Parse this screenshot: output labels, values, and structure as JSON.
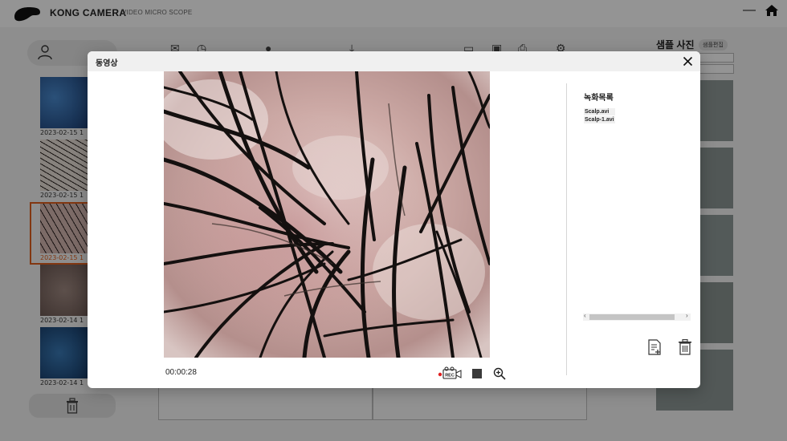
{
  "app": {
    "brand": "KONG CAMERA",
    "brand_sub": "VIDEO MICRO SCOPE",
    "minimize_glyph": "—"
  },
  "left_panel": {
    "thumbnails": [
      {
        "date": "2023-02-15  1",
        "tone": "#2a5b93"
      },
      {
        "date": "2023-02-15  1",
        "tone": "#d9cfc4"
      },
      {
        "date": "2023-02-15  1",
        "tone": "#c6a9a3"
      },
      {
        "date": "2023-02-14  1",
        "tone": "#7e6a64"
      },
      {
        "date": "2023-02-14  1",
        "tone": "#1f4e7d"
      }
    ]
  },
  "right_panel": {
    "title": "샘플 사진",
    "badge": "샘플편집"
  },
  "modal": {
    "title": "동영상",
    "timecode": "00:00:28",
    "list_title": "녹화목록",
    "recordings": [
      "Scalp.avi",
      "Scalp-1.avi"
    ],
    "rec_label": "REC"
  },
  "icons": {
    "close": "close-icon",
    "rec": "record-camera-icon",
    "stop": "stop-icon",
    "zoom": "zoom-in-icon",
    "save_list": "add-document-icon",
    "delete": "trash-icon"
  },
  "colors": {
    "accent_selection": "#e0601e",
    "rec_dot": "#e02020",
    "modal_header": "#f0f0f0"
  }
}
